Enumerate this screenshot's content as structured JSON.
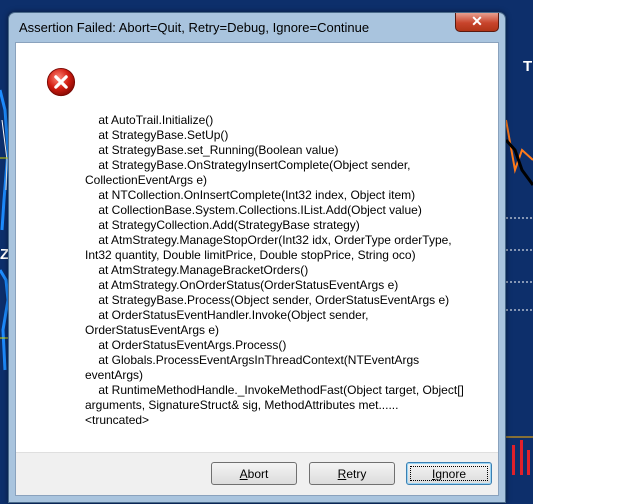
{
  "background": {
    "right_label": "T",
    "left_label": "Z"
  },
  "dialog": {
    "title": "Assertion Failed: Abort=Quit, Retry=Debug, Ignore=Continue",
    "close_glyph": "✕",
    "icon": "error-icon",
    "message_lines": [
      "    at AutoTrail.Initialize()",
      "    at StrategyBase.SetUp()",
      "    at StrategyBase.set_Running(Boolean value)",
      "    at StrategyBase.OnStrategyInsertComplete(Object sender,",
      "CollectionEventArgs e)",
      "    at NTCollection.OnInsertComplete(Int32 index, Object item)",
      "    at CollectionBase.System.Collections.IList.Add(Object value)",
      "    at StrategyCollection.Add(StrategyBase strategy)",
      "    at AtmStrategy.ManageStopOrder(Int32 idx, OrderType orderType,",
      "Int32 quantity, Double limitPrice, Double stopPrice, String oco)",
      "    at AtmStrategy.ManageBracketOrders()",
      "    at AtmStrategy.OnOrderStatus(OrderStatusEventArgs e)",
      "    at StrategyBase.Process(Object sender, OrderStatusEventArgs e)",
      "    at OrderStatusEventHandler.Invoke(Object sender,",
      "OrderStatusEventArgs e)",
      "    at OrderStatusEventArgs.Process()",
      "    at Globals.ProcessEventArgsInThreadContext(NTEventArgs",
      "eventArgs)",
      "    at RuntimeMethodHandle._InvokeMethodFast(Object target, Object[]",
      "arguments, SignatureStruct& sig, MethodAttributes met......",
      "<truncated>"
    ],
    "buttons": {
      "abort_first": "A",
      "abort_rest": "bort",
      "retry_first": "R",
      "retry_rest": "etry",
      "ignore_first": "I",
      "ignore_rest": "gnore"
    }
  },
  "colors": {
    "chart_bg": "#0d2f6b",
    "close_red": "#c8442c",
    "frame": "#a9c4de"
  }
}
